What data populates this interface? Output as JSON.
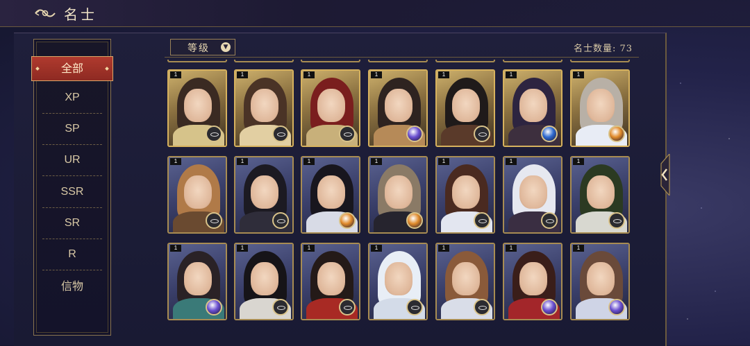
{
  "header": {
    "title": "名士"
  },
  "sidebar": {
    "items": [
      {
        "label": "全部",
        "active": true
      },
      {
        "label": "XP"
      },
      {
        "label": "SP"
      },
      {
        "label": "UR"
      },
      {
        "label": "SSR"
      },
      {
        "label": "SR"
      },
      {
        "label": "R"
      },
      {
        "label": "信物"
      }
    ]
  },
  "toolbar": {
    "sort_label": "等级",
    "count_label": "名士数量: 73"
  },
  "cards": [
    {
      "row": 0,
      "col": 0,
      "level": "1",
      "bg": "gold",
      "hair": "#3a2a22",
      "robe": "#d6c38a",
      "badge": "crest"
    },
    {
      "row": 0,
      "col": 1,
      "level": "1",
      "bg": "gold",
      "hair": "#4a3326",
      "robe": "#e2cfa2",
      "badge": "crest"
    },
    {
      "row": 0,
      "col": 2,
      "level": "1",
      "bg": "gold",
      "hair": "#7a1e1e",
      "robe": "#c8b07a",
      "badge": "crest"
    },
    {
      "row": 0,
      "col": 3,
      "level": "1",
      "bg": "gold",
      "hair": "#2e2320",
      "robe": "#b68a58",
      "badge": "orb-purple"
    },
    {
      "row": 0,
      "col": 4,
      "level": "1",
      "bg": "gold",
      "hair": "#1f1a1a",
      "robe": "#5a3a2a",
      "badge": "crest"
    },
    {
      "row": 0,
      "col": 5,
      "level": "1",
      "bg": "gold",
      "hair": "#2d2440",
      "robe": "#3d2f3e",
      "badge": "orb-blue"
    },
    {
      "row": 0,
      "col": 6,
      "level": "1",
      "bg": "gold",
      "hair": "#b8b0a6",
      "robe": "#e8ecf5",
      "badge": "orb-orange"
    },
    {
      "row": 1,
      "col": 0,
      "level": "1",
      "bg": "blue",
      "hair": "#b07a48",
      "robe": "#6a4a30",
      "badge": "crest"
    },
    {
      "row": 1,
      "col": 1,
      "level": "1",
      "bg": "blue",
      "hair": "#1c1a22",
      "robe": "#2f2d3a",
      "badge": "crest"
    },
    {
      "row": 1,
      "col": 2,
      "level": "1",
      "bg": "blue",
      "hair": "#18161e",
      "robe": "#d8dbe6",
      "badge": "orb-orange"
    },
    {
      "row": 1,
      "col": 3,
      "level": "1",
      "bg": "blue",
      "hair": "#8a7a66",
      "robe": "#26242e",
      "badge": "orb-orange"
    },
    {
      "row": 1,
      "col": 4,
      "level": "1",
      "bg": "blue",
      "hair": "#4a2a20",
      "robe": "#e3e6f0",
      "badge": "crest"
    },
    {
      "row": 1,
      "col": 5,
      "level": "1",
      "bg": "blue",
      "hair": "#e6e8f0",
      "robe": "#3a2e42",
      "badge": "crest"
    },
    {
      "row": 1,
      "col": 6,
      "level": "1",
      "bg": "blue",
      "hair": "#2b3a22",
      "robe": "#d8d8d0",
      "badge": "crest"
    },
    {
      "row": 2,
      "col": 0,
      "level": "1",
      "bg": "blue",
      "hair": "#2a2226",
      "robe": "#3a7a78",
      "badge": "orb-purple"
    },
    {
      "row": 2,
      "col": 1,
      "level": "1",
      "bg": "blue",
      "hair": "#161418",
      "robe": "#d9d6d0",
      "badge": "crest"
    },
    {
      "row": 2,
      "col": 2,
      "level": "1",
      "bg": "blue",
      "hair": "#241a18",
      "robe": "#a82a24",
      "badge": "crest"
    },
    {
      "row": 2,
      "col": 3,
      "level": "1",
      "bg": "blue",
      "hair": "#e8eef6",
      "robe": "#d3dbe8",
      "badge": "crest"
    },
    {
      "row": 2,
      "col": 4,
      "level": "1",
      "bg": "blue",
      "hair": "#8a5a3a",
      "robe": "#d9dde8",
      "badge": "crest"
    },
    {
      "row": 2,
      "col": 5,
      "level": "1",
      "bg": "blue",
      "hair": "#3a1e1a",
      "robe": "#a3262a",
      "badge": "orb-purple"
    },
    {
      "row": 2,
      "col": 6,
      "level": "1",
      "bg": "blue",
      "hair": "#6a4a3a",
      "robe": "#cfd4e6",
      "badge": "orb-purple"
    }
  ]
}
